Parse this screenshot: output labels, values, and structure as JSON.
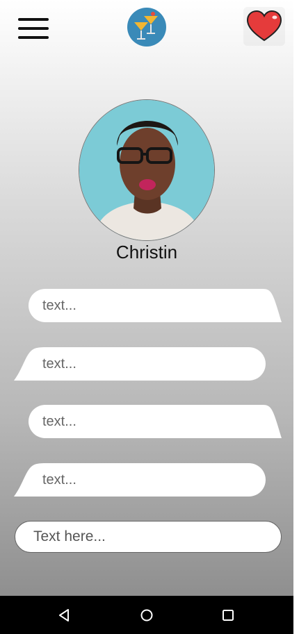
{
  "header": {
    "menu_icon": "hamburger-icon",
    "logo_icon": "cocktail-glasses-icon",
    "favorite_icon": "heart-icon",
    "favorite_color": "#e53b3b"
  },
  "profile": {
    "name": "Christin",
    "photo": "portrait-photo"
  },
  "messages": [
    {
      "text": "text...",
      "side": "right"
    },
    {
      "text": "text...",
      "side": "left"
    },
    {
      "text": "text...",
      "side": "right"
    },
    {
      "text": "text...",
      "side": "left"
    }
  ],
  "composer": {
    "placeholder": "Text here...",
    "value": ""
  },
  "system_nav": {
    "back_icon": "back-triangle-icon",
    "home_icon": "home-circle-icon",
    "recents_icon": "recents-square-icon"
  }
}
